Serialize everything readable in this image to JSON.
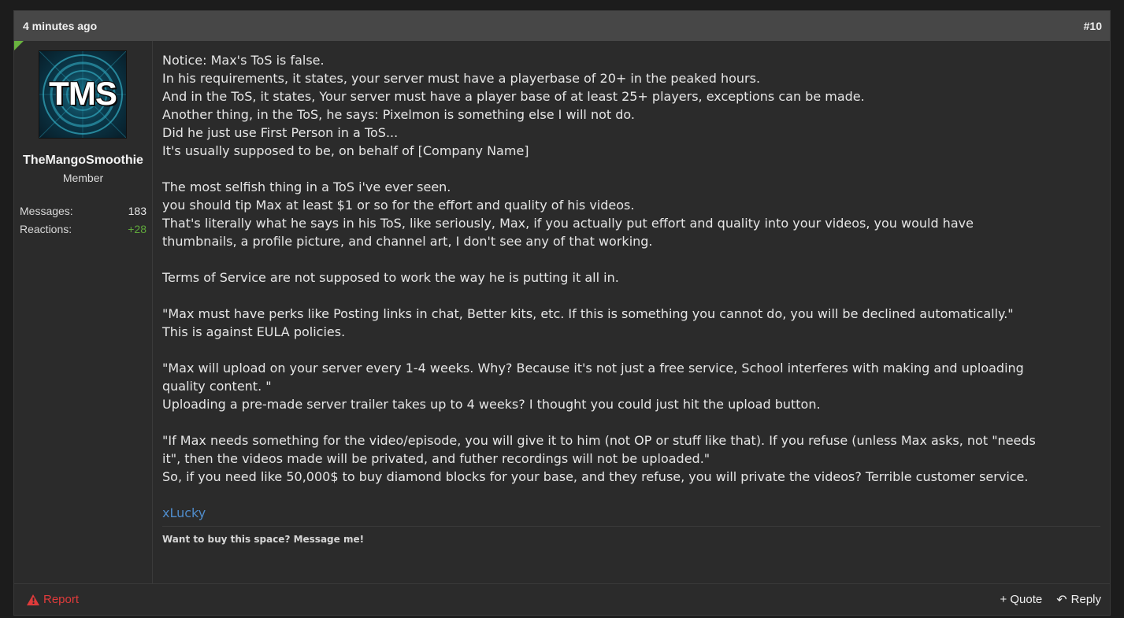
{
  "post": {
    "timestamp": "4 minutes ago",
    "number": "#10"
  },
  "user": {
    "avatar_text": "TMS",
    "name": "TheMangoSmoothie",
    "title": "Member",
    "stats": {
      "messages_label": "Messages:",
      "messages_value": "183",
      "reactions_label": "Reactions:",
      "reactions_value": "+28"
    }
  },
  "message": {
    "paragraphs": [
      [
        "Notice: Max's ToS is false.",
        "In his requirements, it states, your server must have a playerbase of 20+ in the peaked hours.",
        "And in the ToS, it states, Your server must have a player base of at least 25+ players, exceptions can be made.",
        "Another thing, in the ToS, he says: Pixelmon is something else I will not do.",
        "Did he just use First Person in a ToS...",
        "It's usually supposed to be, on behalf of [Company Name]"
      ],
      [
        "The most selfish thing in a ToS i've ever seen.",
        "you should tip Max at least $1 or so for the effort and quality of his videos.",
        "That's literally what he says in his ToS, like seriously, Max, if you actually put effort and quality into your videos, you would have",
        "thumbnails, a profile picture, and channel art, I don't see any of that working."
      ],
      [
        "Terms of Service are not supposed to work the way he is putting it all in."
      ],
      [
        "\"Max must have perks like Posting links in chat, Better kits, etc. If this is something you cannot do, you will be declined automatically.\"",
        "This is against EULA policies."
      ],
      [
        "\"Max will upload on your server every 1-4 weeks. Why? Because it's not just a free service, School interferes with making and uploading",
        "quality content. \"",
        "Uploading a pre-made server trailer takes up to 4 weeks? I thought you could just hit the upload button."
      ],
      [
        "\"If Max needs something for the video/episode, you will give it to him (not OP or stuff like that). If you refuse (unless Max asks, not \"needs",
        "it\", then the videos made will be privated, and futher recordings will not be uploaded.\"",
        "So, if you need like 50,000$ to buy diamond blocks for your base, and they refuse, you will private the videos? Terrible customer service."
      ]
    ]
  },
  "signature": {
    "name": "xLucky",
    "text": "Want to buy this space? Message me!"
  },
  "footer": {
    "report_label": "Report",
    "quote_label": "+ Quote",
    "reply_label": "Reply"
  },
  "colors": {
    "accent_link": "#4f8ccb",
    "report_red": "#e03b3b",
    "reactions_green": "#5fa83b",
    "corner_green": "#6ab43f"
  }
}
